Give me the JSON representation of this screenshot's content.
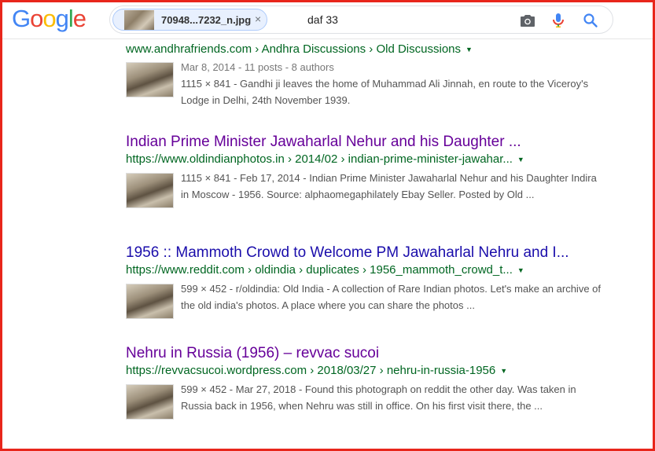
{
  "logo_letters": [
    {
      "ch": "G",
      "color": "#4285F4"
    },
    {
      "ch": "o",
      "color": "#EA4335"
    },
    {
      "ch": "o",
      "color": "#FBBC05"
    },
    {
      "ch": "g",
      "color": "#4285F4"
    },
    {
      "ch": "l",
      "color": "#34A853"
    },
    {
      "ch": "e",
      "color": "#EA4335"
    }
  ],
  "search": {
    "image_chip_name": "70948...7232_n.jpg",
    "close_glyph": "×",
    "query": "daf 33"
  },
  "results": [
    {
      "title": "",
      "url": "www.andhrafriends.com › Andhra Discussions › Old Discussions",
      "arrow": "▼",
      "meta": "Mar 8, 2014 - 11 posts - 8 authors",
      "snippet": "1115 × 841 - Gandhi ji leaves the home of Muhammad Ali Jinnah, en route to the Viceroy's Lodge in Delhi, 24th November 1939."
    },
    {
      "title": "Indian Prime Minister Jawaharlal Nehur and his Daughter ...",
      "url": "https://www.oldindianphotos.in › 2014/02 › indian-prime-minister-jawahar...",
      "arrow": "▼",
      "meta": "",
      "snippet": "1115 × 841 - Feb 17, 2014 - Indian Prime Minister Jawaharlal Nehur and his Daughter Indira in Moscow - 1956. Source: alphaomegaphilately Ebay Seller. Posted by Old ..."
    },
    {
      "title": "1956 :: Mammoth Crowd to Welcome PM Jawaharlal Nehru and I...",
      "url": "https://www.reddit.com › oldindia › duplicates › 1956_mammoth_crowd_t...",
      "arrow": "▼",
      "meta": "",
      "snippet": "599 × 452 - r/oldindia: Old India - A collection of Rare Indian photos. Let's make an archive of the old india's photos. A place where you can share the photos ..."
    },
    {
      "title": "Nehru in Russia (1956) – revvac sucoi",
      "url": "https://revvacsucoi.wordpress.com › 2018/03/27 › nehru-in-russia-1956",
      "arrow": "▼",
      "meta": "",
      "snippet": "599 × 452 - Mar 27, 2018 - Found this photograph on reddit the other day. Was taken in Russia back in 1956, when Nehru was still in office. On his first visit there, the ..."
    }
  ]
}
